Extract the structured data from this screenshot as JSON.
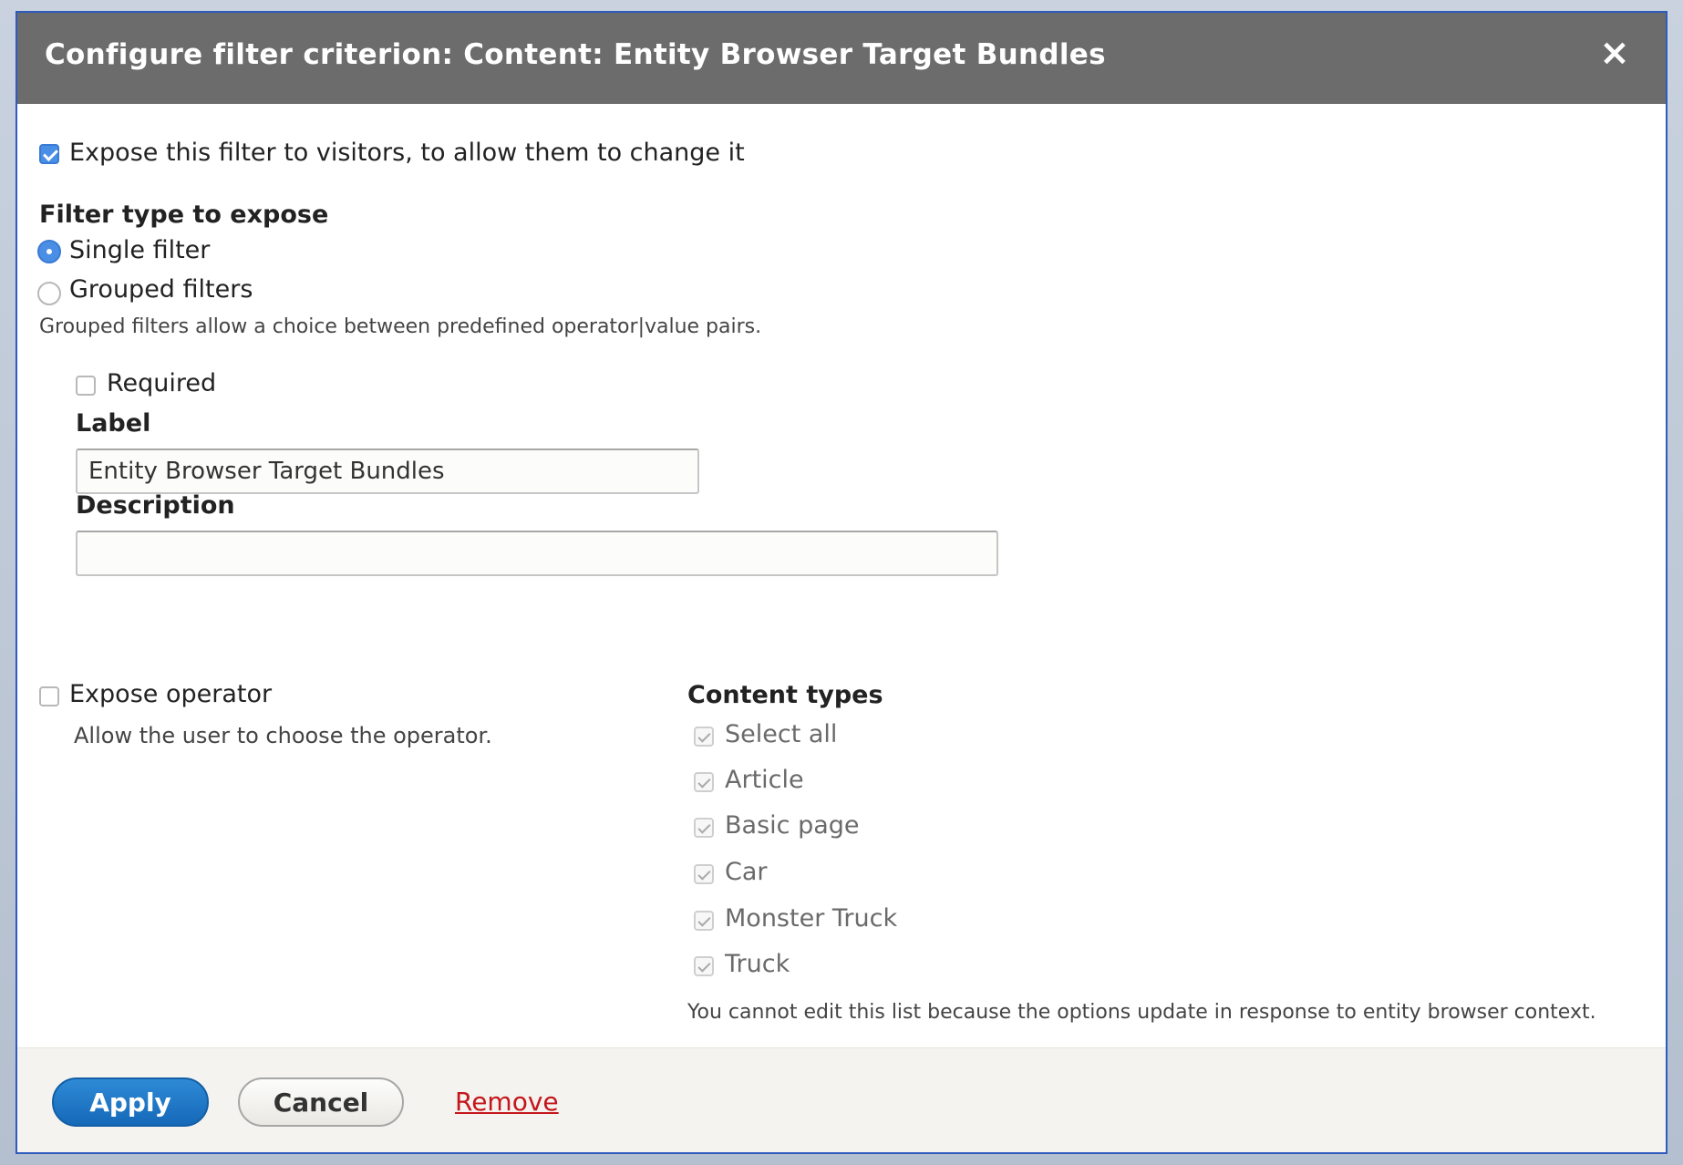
{
  "dialog": {
    "title": "Configure filter criterion: Content: Entity Browser Target Bundles",
    "close_icon": "×"
  },
  "expose": {
    "label": "Expose this filter to visitors, to allow them to change it",
    "checked": true
  },
  "filter_type": {
    "heading": "Filter type to expose",
    "options": [
      {
        "label": "Single filter",
        "selected": true
      },
      {
        "label": "Grouped filters",
        "selected": false
      }
    ],
    "description": "Grouped filters allow a choice between predefined operator|value pairs."
  },
  "required": {
    "label": "Required",
    "checked": false
  },
  "label_field": {
    "label": "Label",
    "value": "Entity Browser Target Bundles"
  },
  "description_field": {
    "label": "Description",
    "value": ""
  },
  "expose_operator": {
    "label": "Expose operator",
    "description": "Allow the user to choose the operator.",
    "checked": false
  },
  "content_types": {
    "heading": "Content types",
    "items": [
      {
        "label": "Select all",
        "checked": true
      },
      {
        "label": "Article",
        "checked": true
      },
      {
        "label": "Basic page",
        "checked": true
      },
      {
        "label": "Car",
        "checked": true
      },
      {
        "label": "Monster Truck",
        "checked": true
      },
      {
        "label": "Truck",
        "checked": true
      }
    ],
    "note": "You cannot edit this list because the options update in response to entity browser context."
  },
  "footer": {
    "apply_label": "Apply",
    "cancel_label": "Cancel",
    "remove_label": "Remove"
  },
  "colors": {
    "titlebar": "#6c6c6c",
    "primary_button": "#1f7acb",
    "checkbox_checked": "#4a8ee6",
    "remove_link": "#c4161c",
    "footer_bg": "#f4f3ef"
  }
}
